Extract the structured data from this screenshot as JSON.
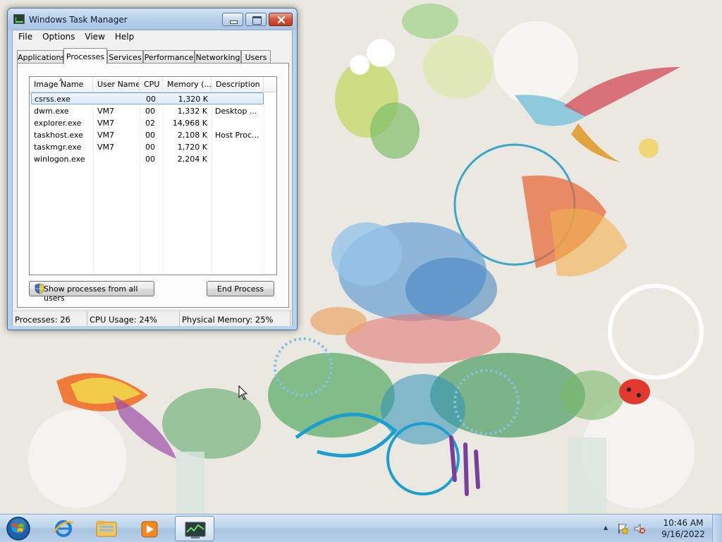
{
  "window": {
    "title": "Windows Task Manager"
  },
  "menu": [
    "File",
    "Options",
    "View",
    "Help"
  ],
  "tabs": [
    "Applications",
    "Processes",
    "Services",
    "Performance",
    "Networking",
    "Users"
  ],
  "active_tab": "Processes",
  "columns": [
    "Image Name",
    "User Name",
    "CPU",
    "Memory (...",
    "Description"
  ],
  "processes": [
    {
      "name": "csrss.exe",
      "user": "",
      "cpu": "00",
      "memory": "1,320 K",
      "description": ""
    },
    {
      "name": "dwm.exe",
      "user": "VM7",
      "cpu": "00",
      "memory": "1,332 K",
      "description": "Desktop ..."
    },
    {
      "name": "explorer.exe",
      "user": "VM7",
      "cpu": "02",
      "memory": "14,968 K",
      "description": ""
    },
    {
      "name": "taskhost.exe",
      "user": "VM7",
      "cpu": "00",
      "memory": "2,108 K",
      "description": "Host Proc..."
    },
    {
      "name": "taskmgr.exe",
      "user": "VM7",
      "cpu": "00",
      "memory": "1,720 K",
      "description": ""
    },
    {
      "name": "winlogon.exe",
      "user": "",
      "cpu": "00",
      "memory": "2,204 K",
      "description": ""
    }
  ],
  "selected_process": "csrss.exe",
  "buttons": {
    "show_all": "Show processes from all users",
    "end_process": "End Process"
  },
  "status": {
    "processes": "Processes: 26",
    "cpu": "CPU Usage: 24%",
    "memory": "Physical Memory: 25%"
  },
  "taskbar": {
    "pinned": [
      "internet-explorer-icon",
      "windows-explorer-icon",
      "media-player-icon",
      "task-manager-icon"
    ],
    "active": "task-manager-icon"
  },
  "clock": {
    "time": "10:46 AM",
    "date": "9/16/2022"
  },
  "colors": {
    "title_bar": "#b9d1ea",
    "selection": "#dcebfc",
    "close_button": "#c13a1f",
    "taskbar": "#bcd3ea"
  }
}
